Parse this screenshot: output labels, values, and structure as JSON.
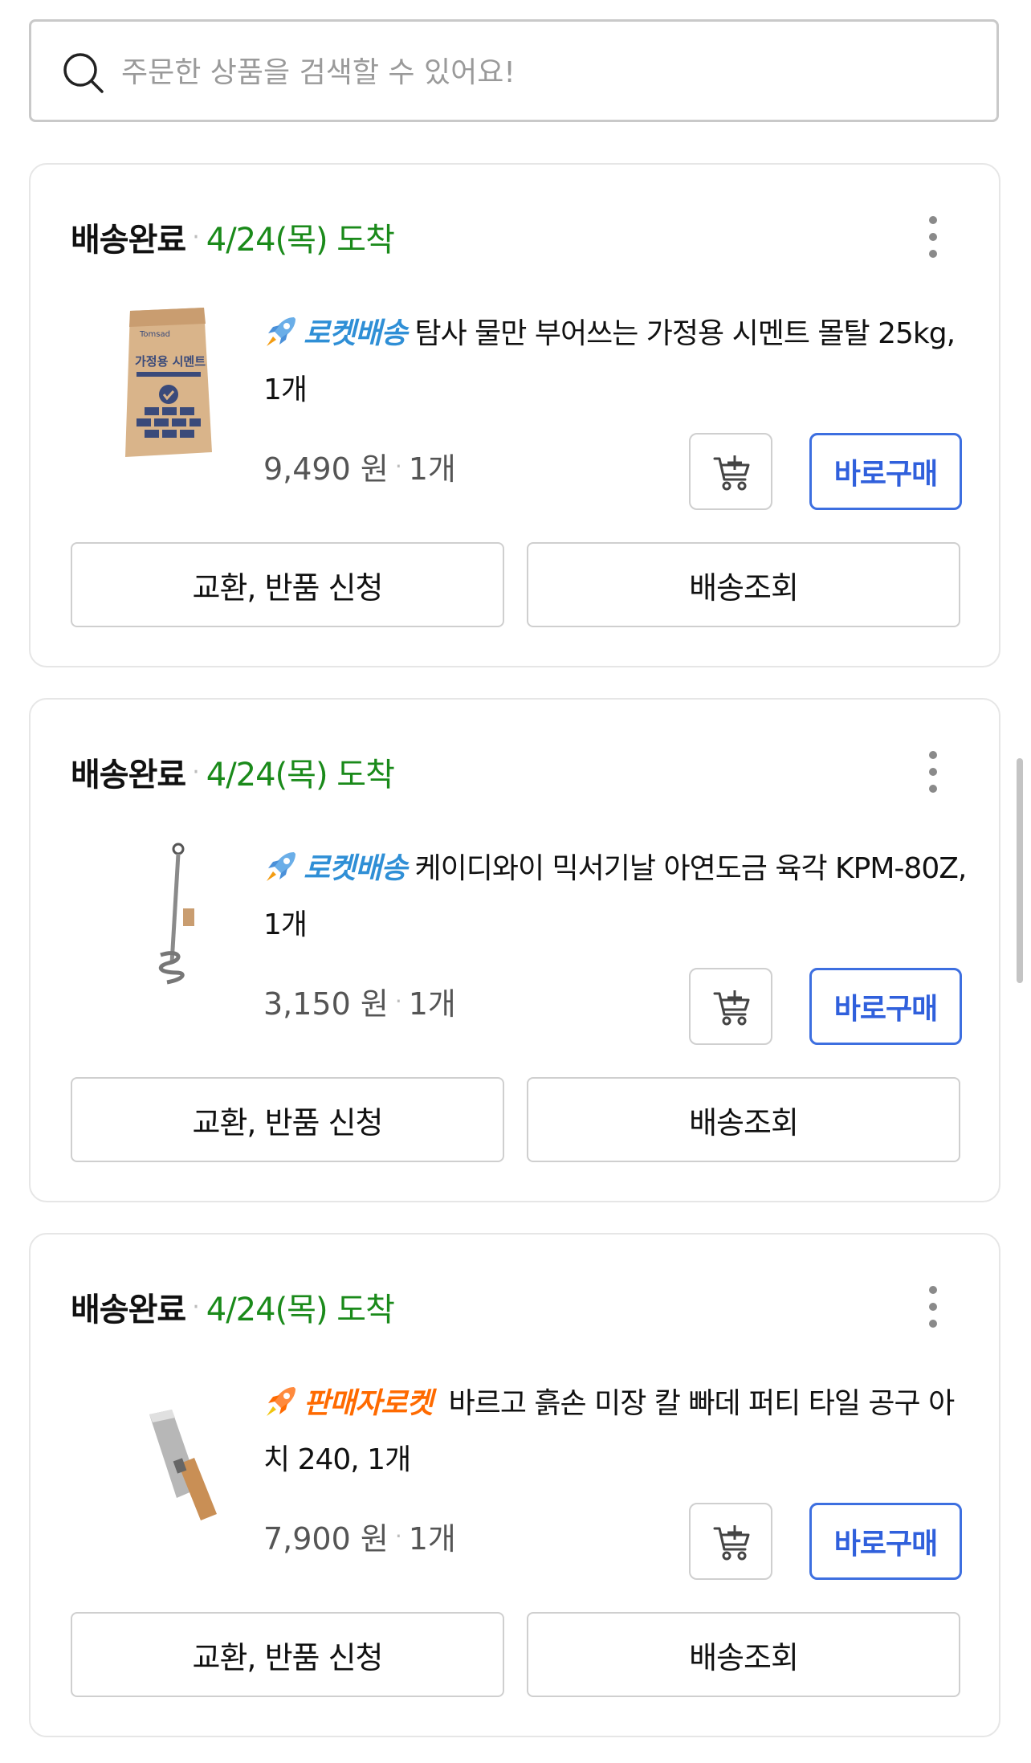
{
  "search": {
    "placeholder": "주문한 상품을 검색할 수 있어요!"
  },
  "colors": {
    "arrival": "#1a8a1a",
    "rocket_badge": "#2f8fd6",
    "seller_badge": "#ff6a00",
    "buy_button": "#3060dc"
  },
  "orders": [
    {
      "status": "배송완료",
      "arrival": "4/24(목) 도착",
      "badge": "로켓배송",
      "badge_icon": "rocket-icon",
      "product_name": "탐사 물만 부어쓰는 가정용 시멘트 몰탈 25kg, 1개",
      "thumb_brand": "Tomsad",
      "thumb_title": "가정용 시멘트",
      "price": "9,490 원",
      "quantity": "1개",
      "buy_label": "바로구매",
      "exchange_label": "교환, 반품 신청",
      "track_label": "배송조회"
    },
    {
      "status": "배송완료",
      "arrival": "4/24(목) 도착",
      "badge": "로켓배송",
      "badge_icon": "rocket-icon",
      "product_name": "케이디와이 믹서기날 아연도금 육각 KPM-80Z, 1개",
      "price": "3,150 원",
      "quantity": "1개",
      "buy_label": "바로구매",
      "exchange_label": "교환, 반품 신청",
      "track_label": "배송조회"
    },
    {
      "status": "배송완료",
      "arrival": "4/24(목) 도착",
      "badge": "판매자로켓",
      "badge_icon": "rocket-icon",
      "product_name": "바르고 흙손 미장 칼 빠데 퍼티 타일 공구 아치 240, 1개",
      "price": "7,900 원",
      "quantity": "1개",
      "buy_label": "바로구매",
      "exchange_label": "교환, 반품 신청",
      "track_label": "배송조회"
    }
  ]
}
